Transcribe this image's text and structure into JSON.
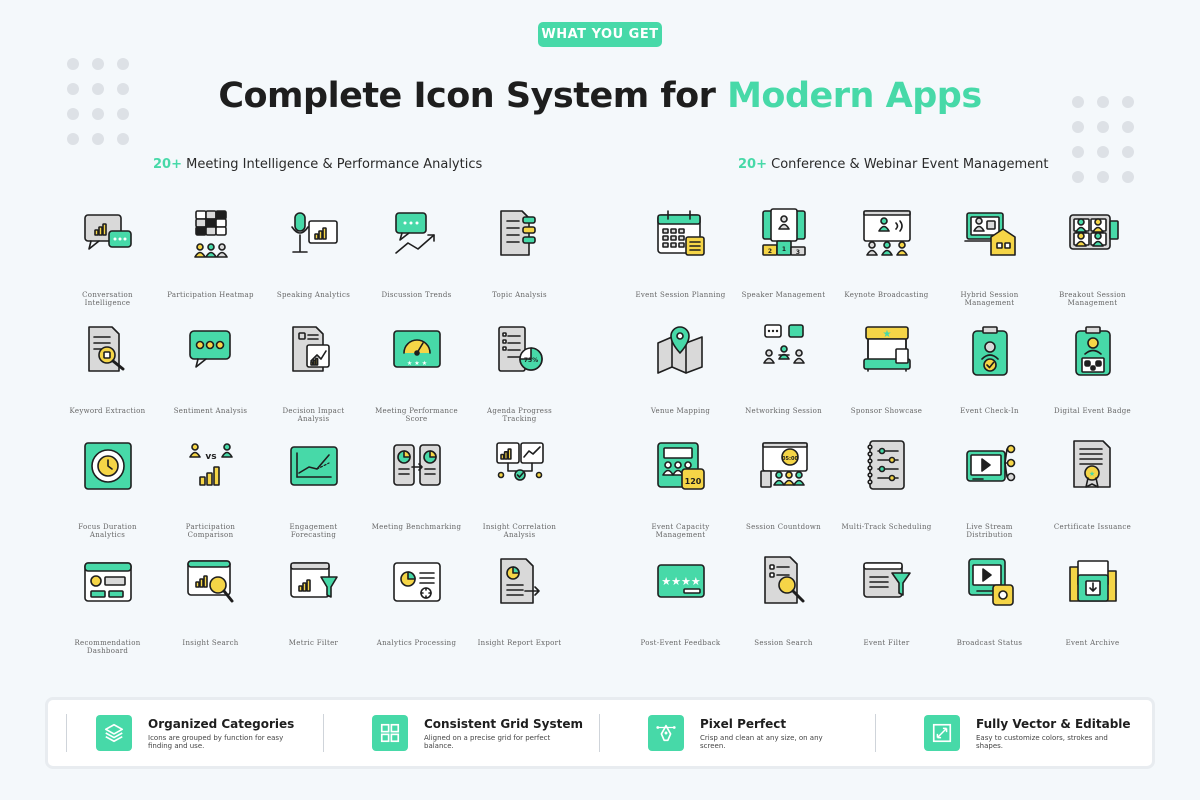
{
  "badge": "WHAT YOU GET",
  "title": {
    "main": "Complete Icon System for ",
    "accent": "Modern Apps"
  },
  "sections": {
    "left": {
      "count": "20+",
      "label": "Meeting Intelligence & Performance Analytics"
    },
    "right": {
      "count": "20+",
      "label": "Conference & Webinar Event Management"
    }
  },
  "left_icons": [
    {
      "label": "Conversation Intelligence",
      "icon": "chat-chart-icon"
    },
    {
      "label": "Participation Heatmap",
      "icon": "heatmap-icon"
    },
    {
      "label": "Speaking Analytics",
      "icon": "microphone-chart-icon"
    },
    {
      "label": "Discussion Trends",
      "icon": "chat-trend-icon"
    },
    {
      "label": "Topic Analysis",
      "icon": "document-tags-icon"
    },
    {
      "label": "Keyword Extraction",
      "icon": "document-search-icon"
    },
    {
      "label": "Sentiment Analysis",
      "icon": "sentiment-chat-icon"
    },
    {
      "label": "Decision Impact Analysis",
      "icon": "document-chart-icon"
    },
    {
      "label": "Meeting Performance Score",
      "icon": "gauge-icon"
    },
    {
      "label": "Agenda Progress Tracking",
      "icon": "checklist-progress-icon"
    },
    {
      "label": "Focus Duration Analytics",
      "icon": "focus-clock-icon"
    },
    {
      "label": "Participation Comparison",
      "icon": "users-vs-icon"
    },
    {
      "label": "Engagement Forecasting",
      "icon": "forecast-board-icon"
    },
    {
      "label": "Meeting Benchmarking",
      "icon": "benchmark-icon"
    },
    {
      "label": "Insight Correlation Analysis",
      "icon": "correlation-icon"
    },
    {
      "label": "Recommendation Dashboard",
      "icon": "dashboard-icon"
    },
    {
      "label": "Insight Search",
      "icon": "chart-search-icon"
    },
    {
      "label": "Metric Filter",
      "icon": "chart-filter-icon"
    },
    {
      "label": "Analytics Processing",
      "icon": "processing-icon"
    },
    {
      "label": "Insight Report Export",
      "icon": "report-export-icon"
    }
  ],
  "right_icons": [
    {
      "label": "Event Session Planning",
      "icon": "calendar-list-icon"
    },
    {
      "label": "Speaker Management",
      "icon": "speaker-podium-icon"
    },
    {
      "label": "Keynote Broadcasting",
      "icon": "keynote-icon"
    },
    {
      "label": "Hybrid Session Management",
      "icon": "hybrid-session-icon"
    },
    {
      "label": "Breakout Session Management",
      "icon": "breakout-icon"
    },
    {
      "label": "Venue Mapping",
      "icon": "map-pin-icon"
    },
    {
      "label": "Networking Session",
      "icon": "networking-icon"
    },
    {
      "label": "Sponsor Showcase",
      "icon": "booth-icon"
    },
    {
      "label": "Event Check-In",
      "icon": "check-in-badge-icon"
    },
    {
      "label": "Digital Event Badge",
      "icon": "qr-badge-icon"
    },
    {
      "label": "Event Capacity Management",
      "icon": "capacity-icon"
    },
    {
      "label": "Session Countdown",
      "icon": "countdown-icon"
    },
    {
      "label": "Multi-Track Scheduling",
      "icon": "notebook-icon"
    },
    {
      "label": "Live Stream Distribution",
      "icon": "live-stream-icon"
    },
    {
      "label": "Certificate Issuance",
      "icon": "certificate-icon"
    },
    {
      "label": "Post-Event Feedback",
      "icon": "feedback-icon"
    },
    {
      "label": "Session Search",
      "icon": "session-search-icon"
    },
    {
      "label": "Event Filter",
      "icon": "event-filter-icon"
    },
    {
      "label": "Broadcast Status",
      "icon": "broadcast-status-icon"
    },
    {
      "label": "Event Archive",
      "icon": "archive-folder-icon"
    }
  ],
  "tile_number": "120",
  "gauge_stars": "★ ★ ★",
  "progress_label": "75%",
  "countdown_label": "05:00",
  "vs_label": "vs",
  "podium_numbers": [
    "2",
    "1",
    "3"
  ],
  "features": [
    {
      "title": "Organized Categories",
      "desc": "Icons are grouped by function for easy finding and use.",
      "icon": "layers-icon"
    },
    {
      "title": "Consistent Grid System",
      "desc": "Aligned on a precise grid for perfect balance.",
      "icon": "grid-icon"
    },
    {
      "title": "Pixel Perfect",
      "desc": "Crisp and clean at any size, on any screen.",
      "icon": "pen-tool-icon"
    },
    {
      "title": "Fully Vector & Editable",
      "desc": "Easy to customize colors, strokes and shapes.",
      "icon": "resize-icon"
    }
  ],
  "colors": {
    "accent": "#47d9a8",
    "yellow": "#f5d547",
    "dark": "#1e1e1e",
    "gray": "#d9d9d9"
  }
}
